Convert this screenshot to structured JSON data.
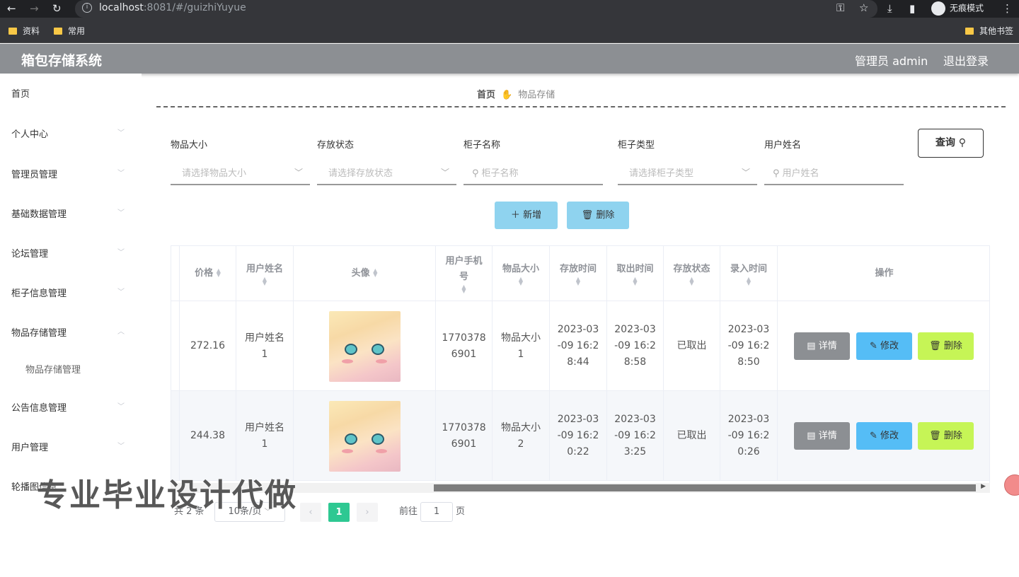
{
  "browser": {
    "url_host": "localhost",
    "url_rest": ":8081/#/guizhiYuyue",
    "incognito_label": "无痕模式",
    "bookmarks": [
      "资料",
      "常用"
    ],
    "other_bookmarks": "其他书签"
  },
  "header": {
    "title": "箱包存储系统",
    "admin": "管理员 admin",
    "logout": "退出登录"
  },
  "sidebar": {
    "items": [
      "首页",
      "个人中心",
      "管理员管理",
      "基础数据管理",
      "论坛管理",
      "柜子信息管理",
      "物品存储管理",
      "公告信息管理",
      "用户管理",
      "轮播图信息"
    ],
    "subitem": "物品存储管理"
  },
  "breadcrumb": {
    "home": "首页",
    "current": "物品存储"
  },
  "search": {
    "fields": [
      {
        "label": "物品大小",
        "placeholder": "请选择物品大小"
      },
      {
        "label": "存放状态",
        "placeholder": "请选择存放状态"
      },
      {
        "label": "柜子名称",
        "placeholder": "柜子名称"
      },
      {
        "label": "柜子类型",
        "placeholder": "请选择柜子类型"
      },
      {
        "label": "用户姓名",
        "placeholder": "用户姓名"
      }
    ],
    "query": "查询"
  },
  "actions": {
    "add": "新增",
    "delete": "删除"
  },
  "table": {
    "headers": [
      "价格",
      "用户姓名",
      "头像",
      "用户手机号",
      "物品大小",
      "存放时间",
      "取出时间",
      "存放状态",
      "录入时间",
      "操作"
    ],
    "rows": [
      {
        "price": "272.16",
        "name": "用户姓名1",
        "phone": "17703786901",
        "size": "物品大小1",
        "store_time": "2023-03-09 16:28:44",
        "take_time": "2023-03-09 16:28:58",
        "status": "已取出",
        "created": "2023-03-09 16:28:50"
      },
      {
        "price": "244.38",
        "name": "用户姓名1",
        "phone": "17703786901",
        "size": "物品大小2",
        "store_time": "2023-03-09 16:20:22",
        "take_time": "2023-03-09 16:23:25",
        "status": "已取出",
        "created": "2023-03-09 16:20:26"
      }
    ],
    "ops": {
      "detail": "详情",
      "edit": "修改",
      "delete": "删除"
    }
  },
  "pagination": {
    "total": "共 2 条",
    "page_size": "10条/页",
    "current": "1",
    "goto": "前往",
    "goto_value": "1",
    "page_unit": "页"
  },
  "watermark": "专业毕业设计代做"
}
